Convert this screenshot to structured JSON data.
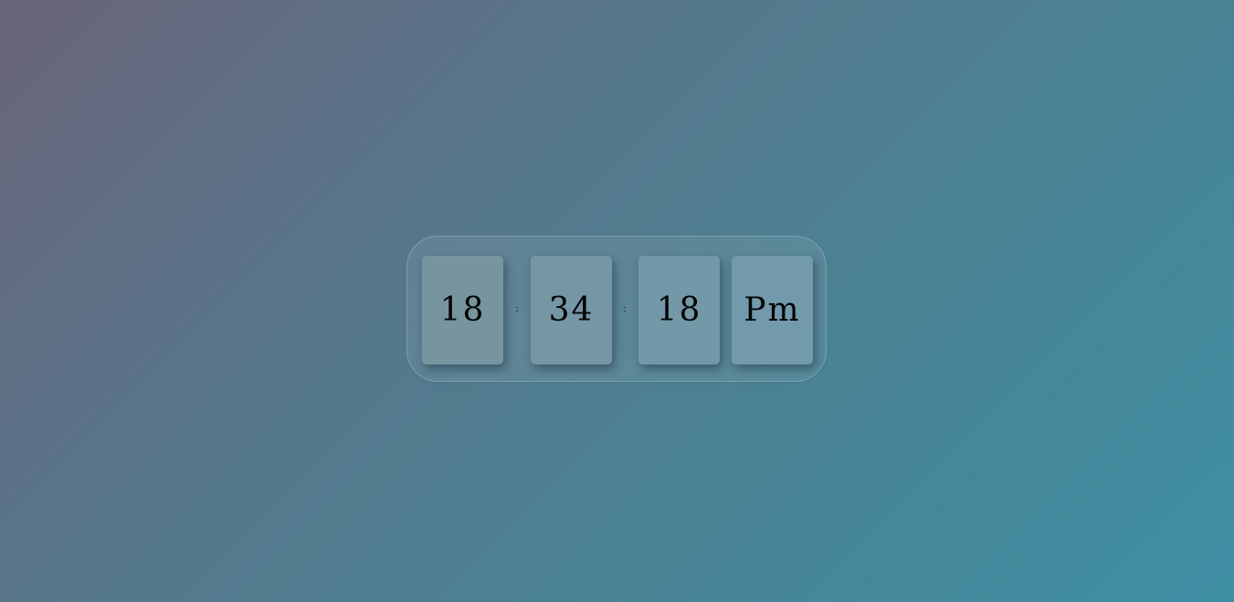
{
  "clock": {
    "hours": "18",
    "minutes": "34",
    "seconds": "18",
    "period": "Pm",
    "separator": ":"
  },
  "colors": {
    "background_start": "#6a6479",
    "background_end": "#3e8ea3",
    "card": "#7597a7",
    "text": "#050505"
  }
}
